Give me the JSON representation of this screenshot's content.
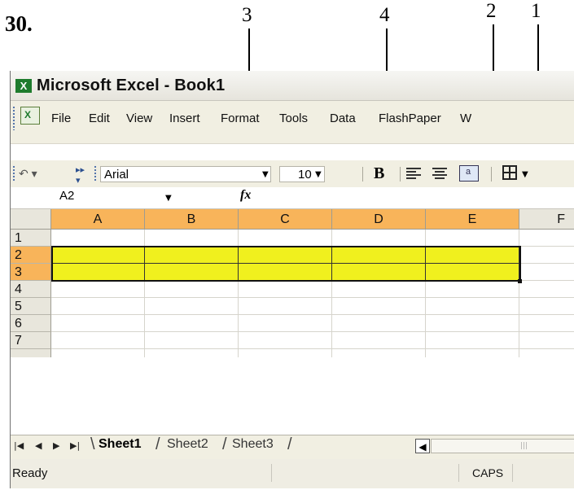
{
  "question_number": "30.",
  "callouts": [
    "3",
    "4",
    "2",
    "1"
  ],
  "window": {
    "title": "Microsoft Excel - Book1"
  },
  "menu": [
    "File",
    "Edit",
    "View",
    "Insert",
    "Format",
    "Tools",
    "Data",
    "FlashPaper",
    "W"
  ],
  "toolbar": {
    "font_name": "Arial",
    "font_size": "10",
    "bold_label": "B",
    "icons": [
      "undo-icon",
      "toolbar-options-icon",
      "bold-icon",
      "align-left-icon",
      "align-center-icon",
      "merge-center-icon",
      "borders-icon"
    ]
  },
  "formula_bar": {
    "name_box": "A2",
    "fx_label": "fx"
  },
  "grid": {
    "columns": [
      "A",
      "B",
      "C",
      "D",
      "E",
      "F"
    ],
    "rows": [
      "1",
      "2",
      "3",
      "4",
      "5",
      "6",
      "7"
    ],
    "selected_range": "A2:E3",
    "selection_fill": "#f0f01e"
  },
  "sheets": [
    "Sheet1",
    "Sheet2",
    "Sheet3"
  ],
  "active_sheet": "Sheet1",
  "status": {
    "text": "Ready",
    "caps": "CAPS"
  }
}
